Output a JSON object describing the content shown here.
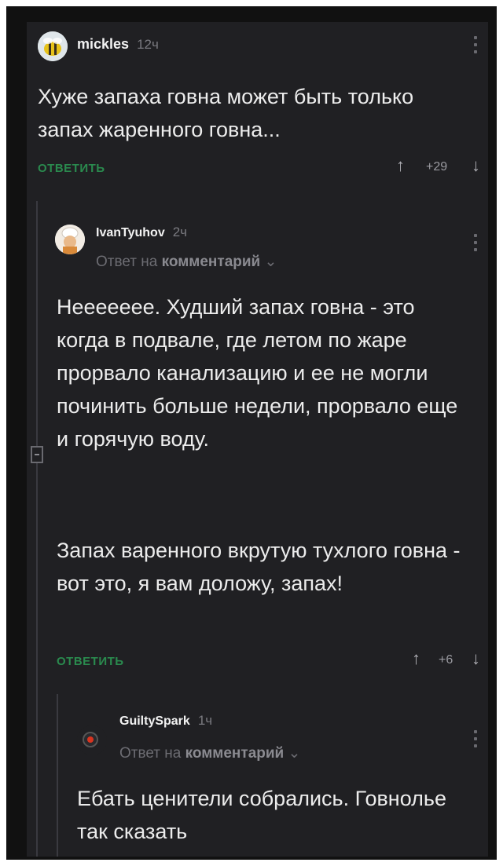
{
  "comments": [
    {
      "username": "mickles",
      "time": "12ч",
      "text": "Хуже запаха говна может быть только запах жаренного говна...",
      "reply_label": "ОТВЕТИТЬ",
      "score": "+29",
      "avatar_icon": "bee-avatar-icon"
    },
    {
      "username": "IvanTyuhov",
      "time": "2ч",
      "reply_prefix": "Ответ на",
      "reply_target": "комментарий",
      "paragraph1": "Неееееее. Худший запах говна - это когда в подвале, где летом по жаре прорвало канализацию и ее не могли починить больше недели, прорвало еще и горячую воду.",
      "paragraph2": "Запах варенного вкрутую тухлого говна - вот это, я вам доложу, запах!",
      "reply_label": "ОТВЕТИТЬ",
      "score": "+6",
      "avatar_icon": "chef-avatar-icon"
    },
    {
      "username": "GuiltySpark",
      "time": "1ч",
      "reply_prefix": "Ответ на",
      "reply_target": "комментарий",
      "text": "Ебать ценители собрались. Говнолье так сказать",
      "avatar_icon": "robot-eye-avatar-icon"
    }
  ],
  "icons": {
    "upvote": "↑",
    "downvote": "↓",
    "dropdown": "⌄"
  }
}
